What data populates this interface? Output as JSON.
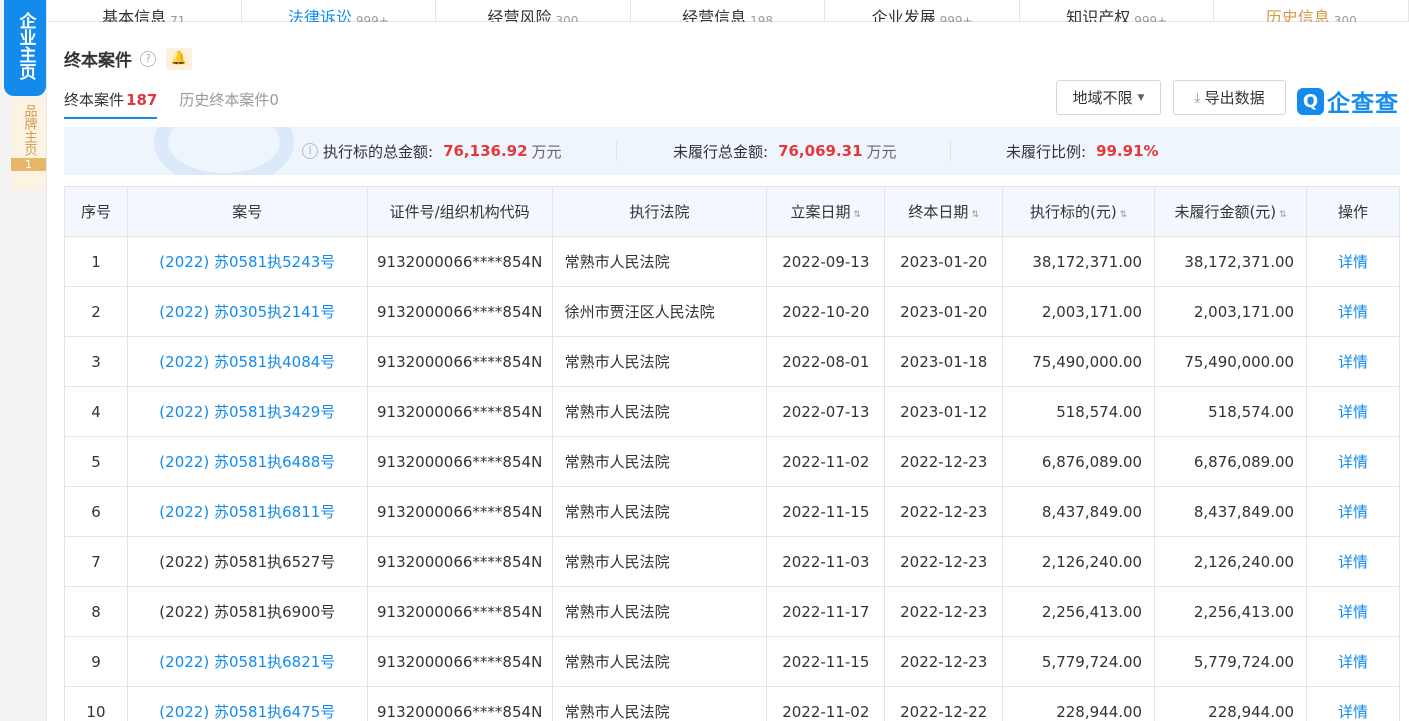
{
  "side_nav": {
    "main_label": "企业主页",
    "brand_label": "品牌主页",
    "brand_count": "1"
  },
  "tabs": [
    {
      "label": "基本信息",
      "count": "71"
    },
    {
      "label": "法律诉讼",
      "count": "999+"
    },
    {
      "label": "经营风险",
      "count": "300"
    },
    {
      "label": "经营信息",
      "count": "198"
    },
    {
      "label": "企业发展",
      "count": "999+"
    },
    {
      "label": "知识产权",
      "count": "999+"
    },
    {
      "label": "历史信息",
      "count": "300"
    }
  ],
  "section": {
    "title": "终本案件",
    "help_icon": "question-circle-icon",
    "bell_icon": "bell-icon"
  },
  "subtabs": {
    "current_label": "终本案件",
    "current_count": "187",
    "history_label": "历史终本案件0"
  },
  "toolbar": {
    "region_label": "地域不限",
    "export_label": "导出数据"
  },
  "brand": {
    "mark": "Q",
    "name": "企查查"
  },
  "summary": {
    "total_label": "执行标的总金额:",
    "total_value": "76,136.92",
    "total_unit": "万元",
    "unfulfilled_label": "未履行总金额:",
    "unfulfilled_value": "76,069.31",
    "unfulfilled_unit": "万元",
    "ratio_label": "未履行比例:",
    "ratio_value": "99.91%"
  },
  "table": {
    "headers": {
      "index": "序号",
      "case_no": "案号",
      "id_code": "证件号/组织机构代码",
      "court": "执行法院",
      "filed_date": "立案日期",
      "end_date": "终本日期",
      "target_amount": "执行标的(元)",
      "unfulfilled_amount": "未履行金额(元)",
      "action": "操作"
    },
    "rows": [
      {
        "index": "1",
        "case_no": "(2022) 苏0581执5243号",
        "id_code": "9132000066****854N",
        "court": "常熟市人民法院",
        "filed": "2022-09-13",
        "end": "2023-01-20",
        "target": "38,172,371.00",
        "unfulfilled": "38,172,371.00",
        "action": "详情"
      },
      {
        "index": "2",
        "case_no": "(2022) 苏0305执2141号",
        "id_code": "9132000066****854N",
        "court": "徐州市贾汪区人民法院",
        "filed": "2022-10-20",
        "end": "2023-01-20",
        "target": "2,003,171.00",
        "unfulfilled": "2,003,171.00",
        "action": "详情"
      },
      {
        "index": "3",
        "case_no": "(2022) 苏0581执4084号",
        "id_code": "9132000066****854N",
        "court": "常熟市人民法院",
        "filed": "2022-08-01",
        "end": "2023-01-18",
        "target": "75,490,000.00",
        "unfulfilled": "75,490,000.00",
        "action": "详情"
      },
      {
        "index": "4",
        "case_no": "(2022) 苏0581执3429号",
        "id_code": "9132000066****854N",
        "court": "常熟市人民法院",
        "filed": "2022-07-13",
        "end": "2023-01-12",
        "target": "518,574.00",
        "unfulfilled": "518,574.00",
        "action": "详情"
      },
      {
        "index": "5",
        "case_no": "(2022) 苏0581执6488号",
        "id_code": "9132000066****854N",
        "court": "常熟市人民法院",
        "filed": "2022-11-02",
        "end": "2022-12-23",
        "target": "6,876,089.00",
        "unfulfilled": "6,876,089.00",
        "action": "详情"
      },
      {
        "index": "6",
        "case_no": "(2022) 苏0581执6811号",
        "id_code": "9132000066****854N",
        "court": "常熟市人民法院",
        "filed": "2022-11-15",
        "end": "2022-12-23",
        "target": "8,437,849.00",
        "unfulfilled": "8,437,849.00",
        "action": "详情"
      },
      {
        "index": "7",
        "case_no": "(2022) 苏0581执6527号",
        "id_code": "9132000066****854N",
        "court": "常熟市人民法院",
        "filed": "2022-11-03",
        "end": "2022-12-23",
        "target": "2,126,240.00",
        "unfulfilled": "2,126,240.00",
        "action": "详情"
      },
      {
        "index": "8",
        "case_no": "(2022) 苏0581执6900号",
        "id_code": "9132000066****854N",
        "court": "常熟市人民法院",
        "filed": "2022-11-17",
        "end": "2022-12-23",
        "target": "2,256,413.00",
        "unfulfilled": "2,256,413.00",
        "action": "详情"
      },
      {
        "index": "9",
        "case_no": "(2022) 苏0581执6821号",
        "id_code": "9132000066****854N",
        "court": "常熟市人民法院",
        "filed": "2022-11-15",
        "end": "2022-12-23",
        "target": "5,779,724.00",
        "unfulfilled": "5,779,724.00",
        "action": "详情"
      },
      {
        "index": "10",
        "case_no": "(2022) 苏0581执6475号",
        "id_code": "9132000066****854N",
        "court": "常熟市人民法院",
        "filed": "2022-11-02",
        "end": "2022-12-22",
        "target": "228,944.00",
        "unfulfilled": "228,944.00",
        "action": "详情"
      }
    ]
  },
  "colors": {
    "accent": "#128bed",
    "highlight": "#e4393c",
    "header_bg": "#f2f8fe",
    "summary_bg": "#eef5fd"
  }
}
